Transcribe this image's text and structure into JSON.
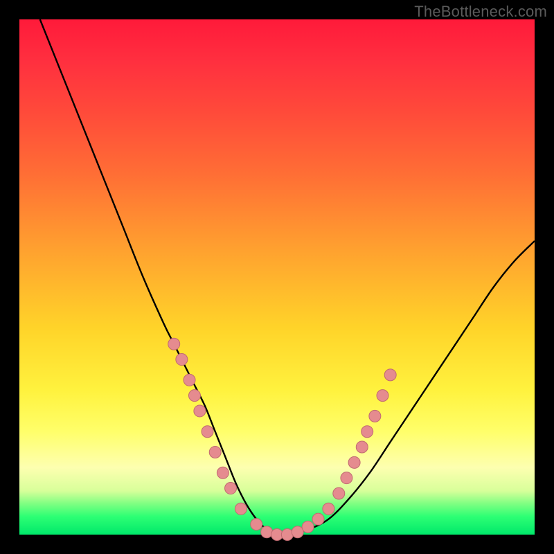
{
  "watermark": "TheBottleneck.com",
  "colors": {
    "frame_bg": "#000000",
    "curve_stroke": "#000000",
    "dot_fill": "#e58b8f",
    "dot_stroke": "#c06a70"
  },
  "chart_data": {
    "type": "line",
    "title": "",
    "xlabel": "",
    "ylabel": "",
    "xlim": [
      0,
      100
    ],
    "ylim": [
      0,
      100
    ],
    "series": [
      {
        "name": "bottleneck-curve",
        "x": [
          4,
          8,
          12,
          16,
          20,
          24,
          28,
          30,
          32,
          34,
          36,
          38,
          40,
          42,
          44,
          46,
          48,
          50,
          52,
          56,
          60,
          64,
          68,
          72,
          76,
          80,
          84,
          88,
          92,
          96,
          100
        ],
        "y": [
          100,
          90,
          80,
          70,
          60,
          50,
          41,
          37,
          33,
          29,
          25,
          20,
          15,
          10,
          6,
          3,
          1,
          0,
          0,
          1,
          3,
          7,
          12,
          18,
          24,
          30,
          36,
          42,
          48,
          53,
          57
        ]
      }
    ],
    "dots": [
      {
        "x": 30.0,
        "y": 37
      },
      {
        "x": 31.5,
        "y": 34
      },
      {
        "x": 33.0,
        "y": 30
      },
      {
        "x": 34.0,
        "y": 27
      },
      {
        "x": 35.0,
        "y": 24
      },
      {
        "x": 36.5,
        "y": 20
      },
      {
        "x": 38.0,
        "y": 16
      },
      {
        "x": 39.5,
        "y": 12
      },
      {
        "x": 41.0,
        "y": 9
      },
      {
        "x": 43.0,
        "y": 5
      },
      {
        "x": 46.0,
        "y": 2
      },
      {
        "x": 48.0,
        "y": 0.5
      },
      {
        "x": 50.0,
        "y": 0
      },
      {
        "x": 52.0,
        "y": 0
      },
      {
        "x": 54.0,
        "y": 0.5
      },
      {
        "x": 56.0,
        "y": 1.5
      },
      {
        "x": 58.0,
        "y": 3
      },
      {
        "x": 60.0,
        "y": 5
      },
      {
        "x": 62.0,
        "y": 8
      },
      {
        "x": 63.5,
        "y": 11
      },
      {
        "x": 65.0,
        "y": 14
      },
      {
        "x": 66.5,
        "y": 17
      },
      {
        "x": 67.5,
        "y": 20
      },
      {
        "x": 69.0,
        "y": 23
      },
      {
        "x": 70.5,
        "y": 27
      },
      {
        "x": 72.0,
        "y": 31
      }
    ]
  }
}
